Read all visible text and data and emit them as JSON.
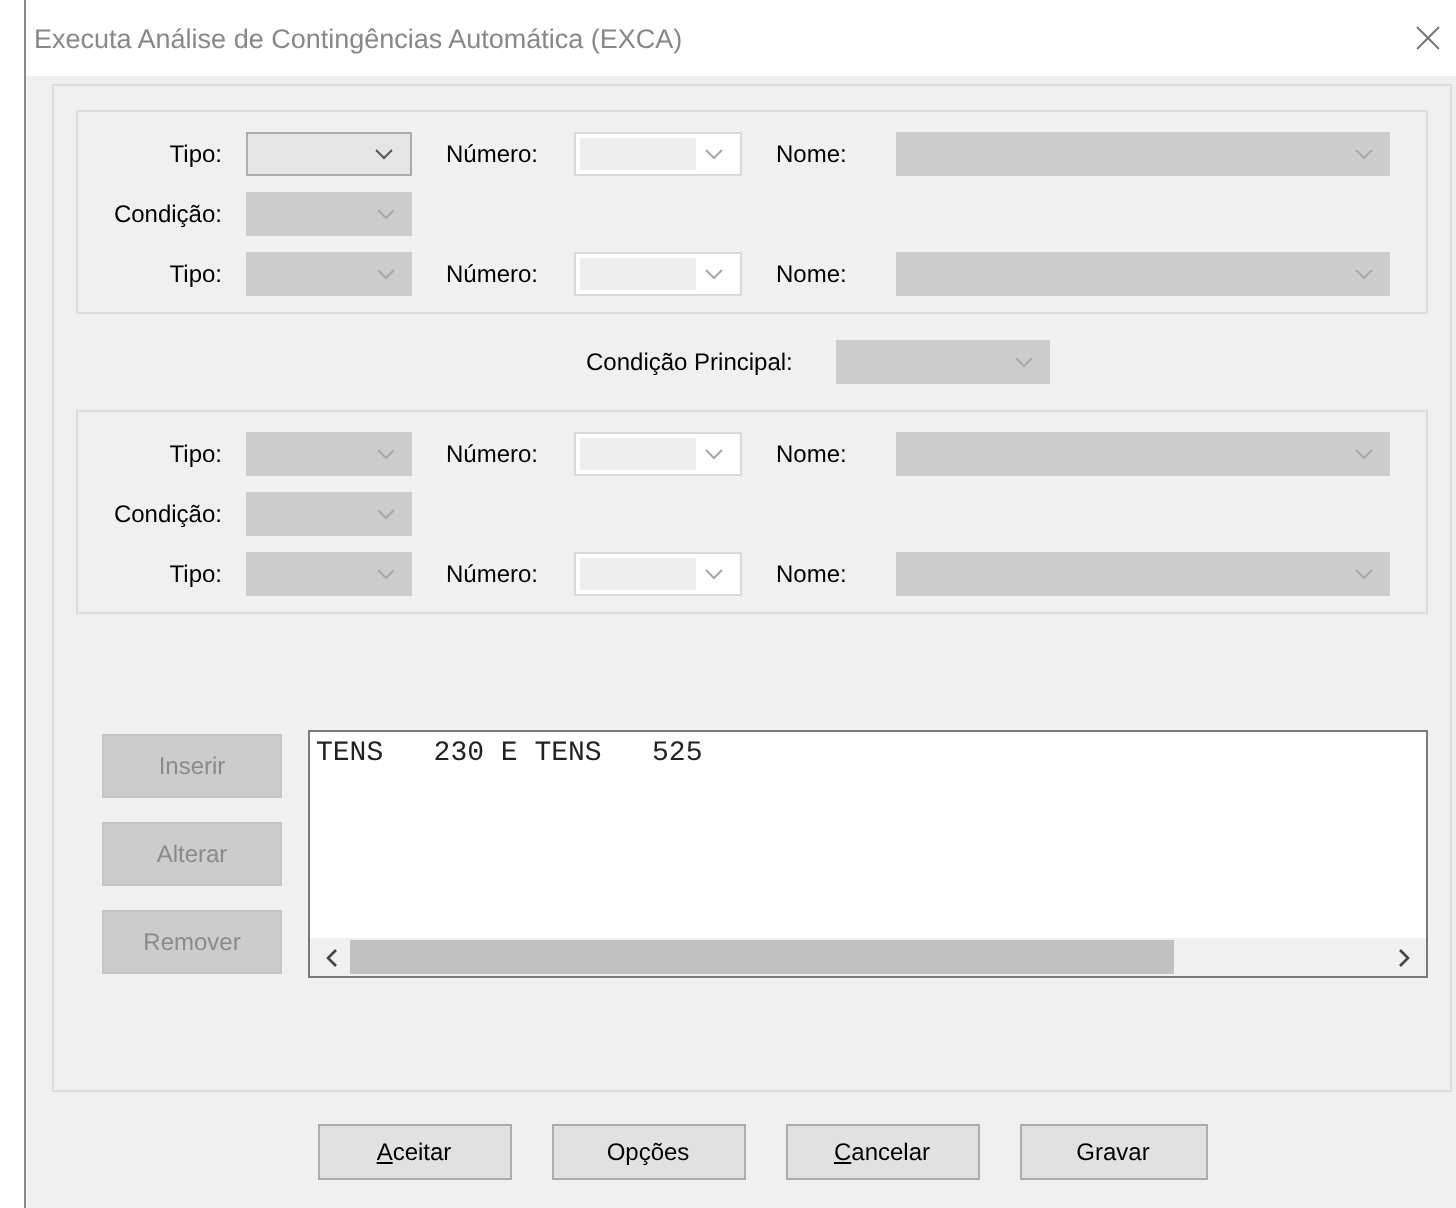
{
  "window": {
    "title": "Executa Análise de Contingências Automática (EXCA)"
  },
  "groups": [
    {
      "rows": [
        {
          "kind": "element",
          "tipo_label": "Tipo:",
          "tipo": {
            "disabled": false
          },
          "numero_label": "Número:",
          "numero": {
            "disabled": true
          },
          "nome_label": "Nome:",
          "nome": {
            "disabled": true
          }
        },
        {
          "kind": "condition",
          "condicao_label": "Condição:",
          "condicao": {
            "disabled": true
          }
        },
        {
          "kind": "element",
          "tipo_label": "Tipo:",
          "tipo": {
            "disabled": true
          },
          "numero_label": "Número:",
          "numero": {
            "disabled": true
          },
          "nome_label": "Nome:",
          "nome": {
            "disabled": true
          }
        }
      ]
    },
    {
      "rows": [
        {
          "kind": "element",
          "tipo_label": "Tipo:",
          "tipo": {
            "disabled": true
          },
          "numero_label": "Número:",
          "numero": {
            "disabled": true
          },
          "nome_label": "Nome:",
          "nome": {
            "disabled": true
          }
        },
        {
          "kind": "condition",
          "condicao_label": "Condição:",
          "condicao": {
            "disabled": true
          }
        },
        {
          "kind": "element",
          "tipo_label": "Tipo:",
          "tipo": {
            "disabled": true
          },
          "numero_label": "Número:",
          "numero": {
            "disabled": true
          },
          "nome_label": "Nome:",
          "nome": {
            "disabled": true
          }
        }
      ]
    }
  ],
  "main_condition": {
    "label": "Condição Principal:",
    "combo": {
      "disabled": true
    }
  },
  "side_buttons": [
    {
      "label": "Inserir",
      "disabled": true
    },
    {
      "label": "Alterar",
      "disabled": true
    },
    {
      "label": "Remover",
      "disabled": true
    }
  ],
  "list": {
    "lines": [
      "TENS   230 E TENS   525"
    ]
  },
  "buttons": [
    {
      "label": "Aceitar",
      "underline_first": true
    },
    {
      "label": "Opções",
      "underline_first": false
    },
    {
      "label": "Cancelar",
      "underline_first": true
    },
    {
      "label": "Gravar",
      "underline_first": false
    }
  ]
}
